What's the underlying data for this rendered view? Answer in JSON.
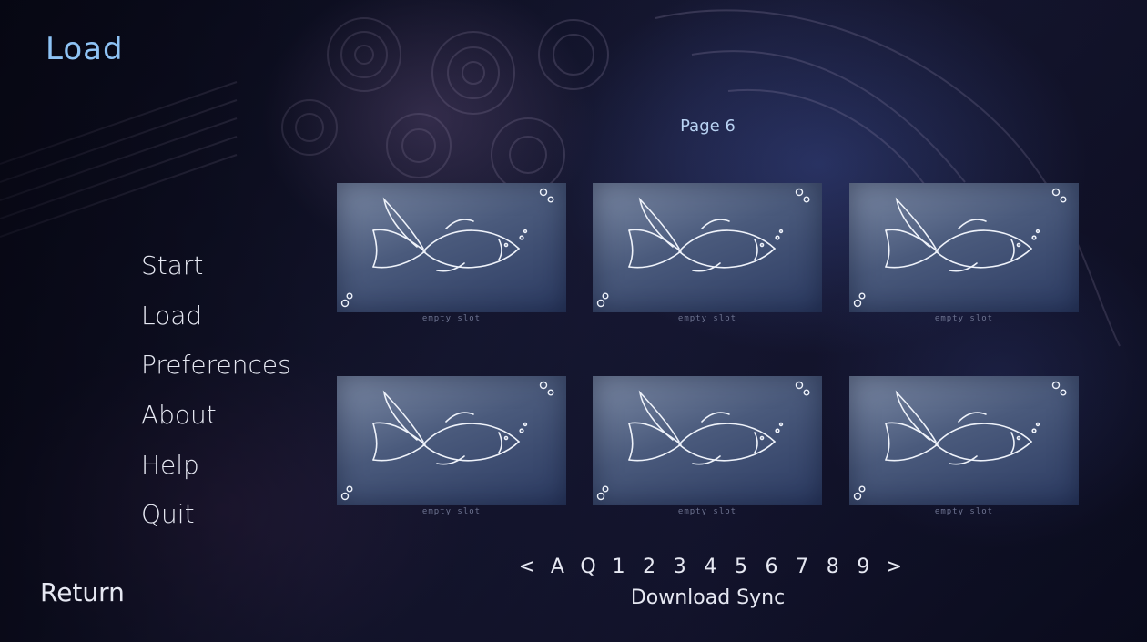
{
  "screen": {
    "title": "Load"
  },
  "nav": {
    "items": [
      "Start",
      "Load",
      "Preferences",
      "About",
      "Help",
      "Quit"
    ],
    "return_label": "Return"
  },
  "slots": {
    "page_label": "Page 6",
    "empty_label": "empty slot",
    "count": 6
  },
  "pager": {
    "prev": "<",
    "auto": "A",
    "quick": "Q",
    "pages": [
      "1",
      "2",
      "3",
      "4",
      "5",
      "6",
      "7",
      "8",
      "9"
    ],
    "next": ">"
  },
  "sync_label": "Download Sync",
  "colors": {
    "title": "#8ec3f5",
    "page_label": "#b8d2f2",
    "text": "#e6e8f2"
  },
  "icons": {
    "slot_placeholder": "fish-outline-icon",
    "title_heart": "heart-icon"
  }
}
